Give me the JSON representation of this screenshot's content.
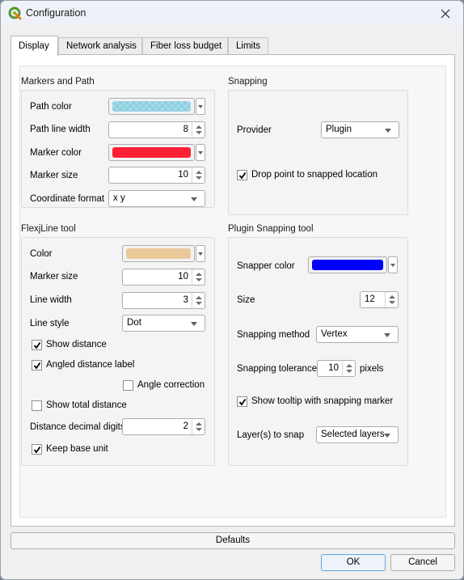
{
  "window": {
    "title": "Configuration",
    "app_icon": "qgis-logo-icon",
    "close_icon": "close-icon"
  },
  "tabs": [
    {
      "label": "Display",
      "active": true
    },
    {
      "label": "Network analysis",
      "active": false
    },
    {
      "label": "Fiber loss budget",
      "active": false
    },
    {
      "label": "Limits",
      "active": false
    }
  ],
  "markers_and_path": {
    "title": "Markers and Path",
    "path_color": {
      "label": "Path color",
      "value": "#8fcfe0",
      "transparent": true
    },
    "path_line_width": {
      "label": "Path line width",
      "value": "8"
    },
    "marker_color": {
      "label": "Marker color",
      "value": "#ff1f35"
    },
    "marker_size": {
      "label": "Marker size",
      "value": "10"
    },
    "coordinate_format": {
      "label": "Coordinate format",
      "value": "x y"
    }
  },
  "snapping": {
    "title": "Snapping",
    "provider": {
      "label": "Provider",
      "value": "Plugin"
    },
    "drop_point": {
      "label": "Drop point to snapped location",
      "checked": true
    }
  },
  "flexjline": {
    "title": "FlexjLine tool",
    "color": {
      "label": "Color",
      "value": "#ebc99a"
    },
    "marker_size": {
      "label": "Marker size",
      "value": "10"
    },
    "line_width": {
      "label": "Line width",
      "value": "3"
    },
    "line_style": {
      "label": "Line style",
      "value": "Dot"
    },
    "show_distance": {
      "label": "Show distance",
      "checked": true
    },
    "angled_distance_label": {
      "label": "Angled distance label",
      "checked": true
    },
    "angle_correction": {
      "label": "Angle correction",
      "checked": false
    },
    "show_total_distance": {
      "label": "Show total distance",
      "checked": false
    },
    "distance_decimal_digits": {
      "label": "Distance decimal digits",
      "value": "2"
    },
    "keep_base_unit": {
      "label": "Keep base unit",
      "checked": true
    }
  },
  "plugin_snapping": {
    "title": "Plugin Snapping tool",
    "snapper_color": {
      "label": "Snapper color",
      "value": "#0000ff"
    },
    "size": {
      "label": "Size",
      "value": "12"
    },
    "snapping_method": {
      "label": "Snapping method",
      "value": "Vertex"
    },
    "snapping_tolerance": {
      "label": "Snapping tolerance",
      "value": "10",
      "unit": "pixels"
    },
    "show_tooltip": {
      "label": "Show tooltip with snapping marker",
      "checked": true
    },
    "layers_to_snap": {
      "label": "Layer(s) to snap",
      "value": "Selected layers"
    }
  },
  "buttons": {
    "defaults": "Defaults",
    "ok": "OK",
    "cancel": "Cancel"
  }
}
